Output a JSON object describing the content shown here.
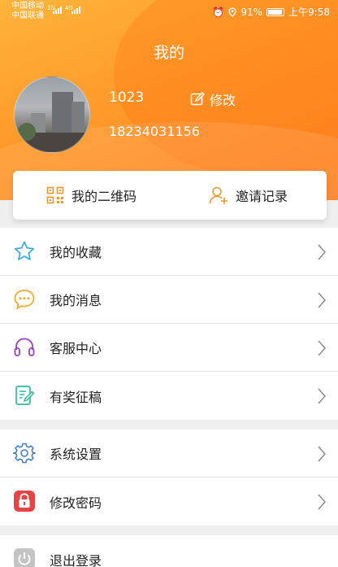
{
  "status_bar": {
    "carrier1": "中国移动",
    "carrier2": "中国联通",
    "net1": "2G",
    "net2": "4G",
    "battery": "91%",
    "time": "上午9:58"
  },
  "header": {
    "title": "我的",
    "username": "1023",
    "edit_label": "修改",
    "phone": "18234031156"
  },
  "card": {
    "qr_label": "我的二维码",
    "invite_label": "邀请记录"
  },
  "menu": [
    {
      "label": "我的收藏",
      "icon": "star-icon",
      "color": "#3aa7e6"
    },
    {
      "label": "我的消息",
      "icon": "message-icon",
      "color": "#f5a623"
    },
    {
      "label": "客服中心",
      "icon": "headset-icon",
      "color": "#9b3ec8"
    },
    {
      "label": "有奖征稿",
      "icon": "edit-document-icon",
      "color": "#2fbf8f"
    },
    {
      "label": "系统设置",
      "icon": "gear-icon",
      "color": "#4a7fc0"
    },
    {
      "label": "修改密码",
      "icon": "lock-icon",
      "color": "#e64545"
    },
    {
      "label": "退出登录",
      "icon": "power-icon",
      "color": "#b0b0b0"
    }
  ],
  "colors": {
    "accent": "#ff9a2a",
    "background": "#efefef"
  }
}
